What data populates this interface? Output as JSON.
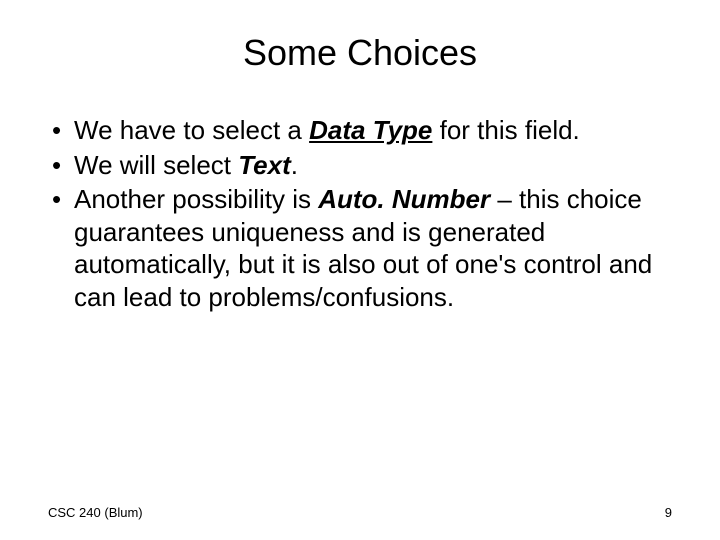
{
  "title": "Some Choices",
  "bullets": {
    "b1_pre": "We have to select a ",
    "b1_dt": "Data Type",
    "b1_post": " for this field.",
    "b2_pre": "We will select ",
    "b2_text": "Text",
    "b2_post": ".",
    "b3_pre": "Another possibility is ",
    "b3_an": "Auto. Number",
    "b3_post": " – this choice guarantees uniqueness and is generated automatically, but it is also out of one's control and can lead to problems/confusions."
  },
  "footer": {
    "left": "CSC 240 (Blum)",
    "right": "9"
  }
}
